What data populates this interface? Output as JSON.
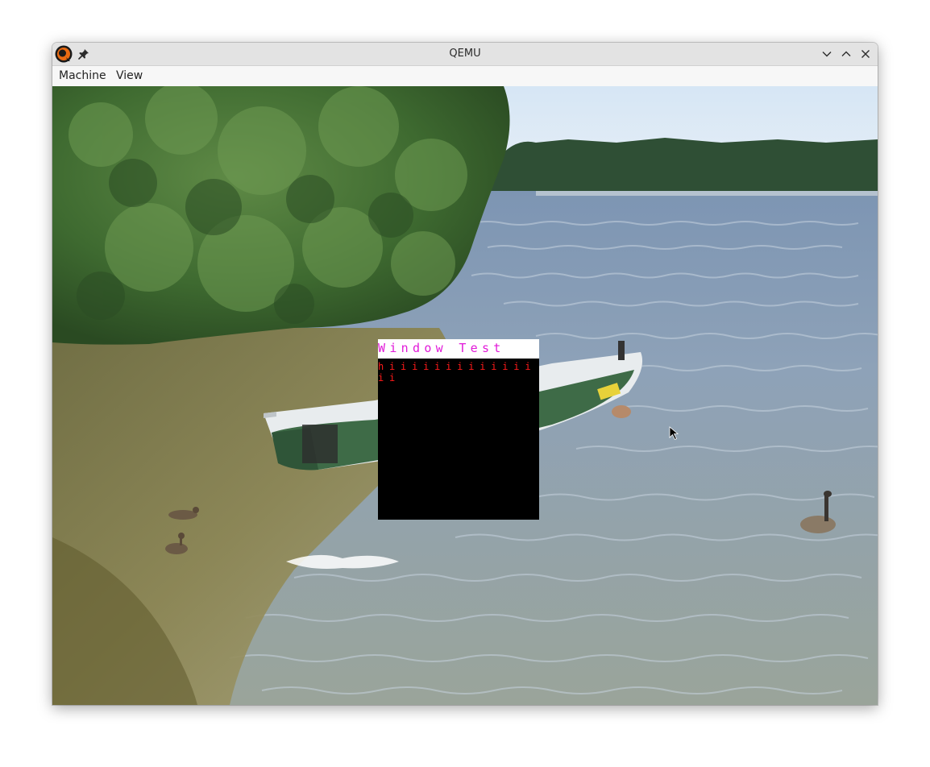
{
  "window": {
    "title": "QEMU"
  },
  "menubar": {
    "items": [
      {
        "label": "Machine"
      },
      {
        "label": "View"
      }
    ]
  },
  "guest": {
    "window_title": "Window Test",
    "text": "hiiiiiiiiiiiiiii"
  },
  "icons": {
    "app": "qemu-logo-icon",
    "pin": "pin-icon",
    "minimize": "chevron-down-icon",
    "maximize": "chevron-up-icon",
    "close": "close-icon",
    "cursor": "arrow-cursor-icon"
  },
  "colors": {
    "guest_title": "#e21ad9",
    "guest_text": "#ff1a1a",
    "guest_bg": "#000000",
    "guest_titlebar_bg": "#ffffff"
  }
}
